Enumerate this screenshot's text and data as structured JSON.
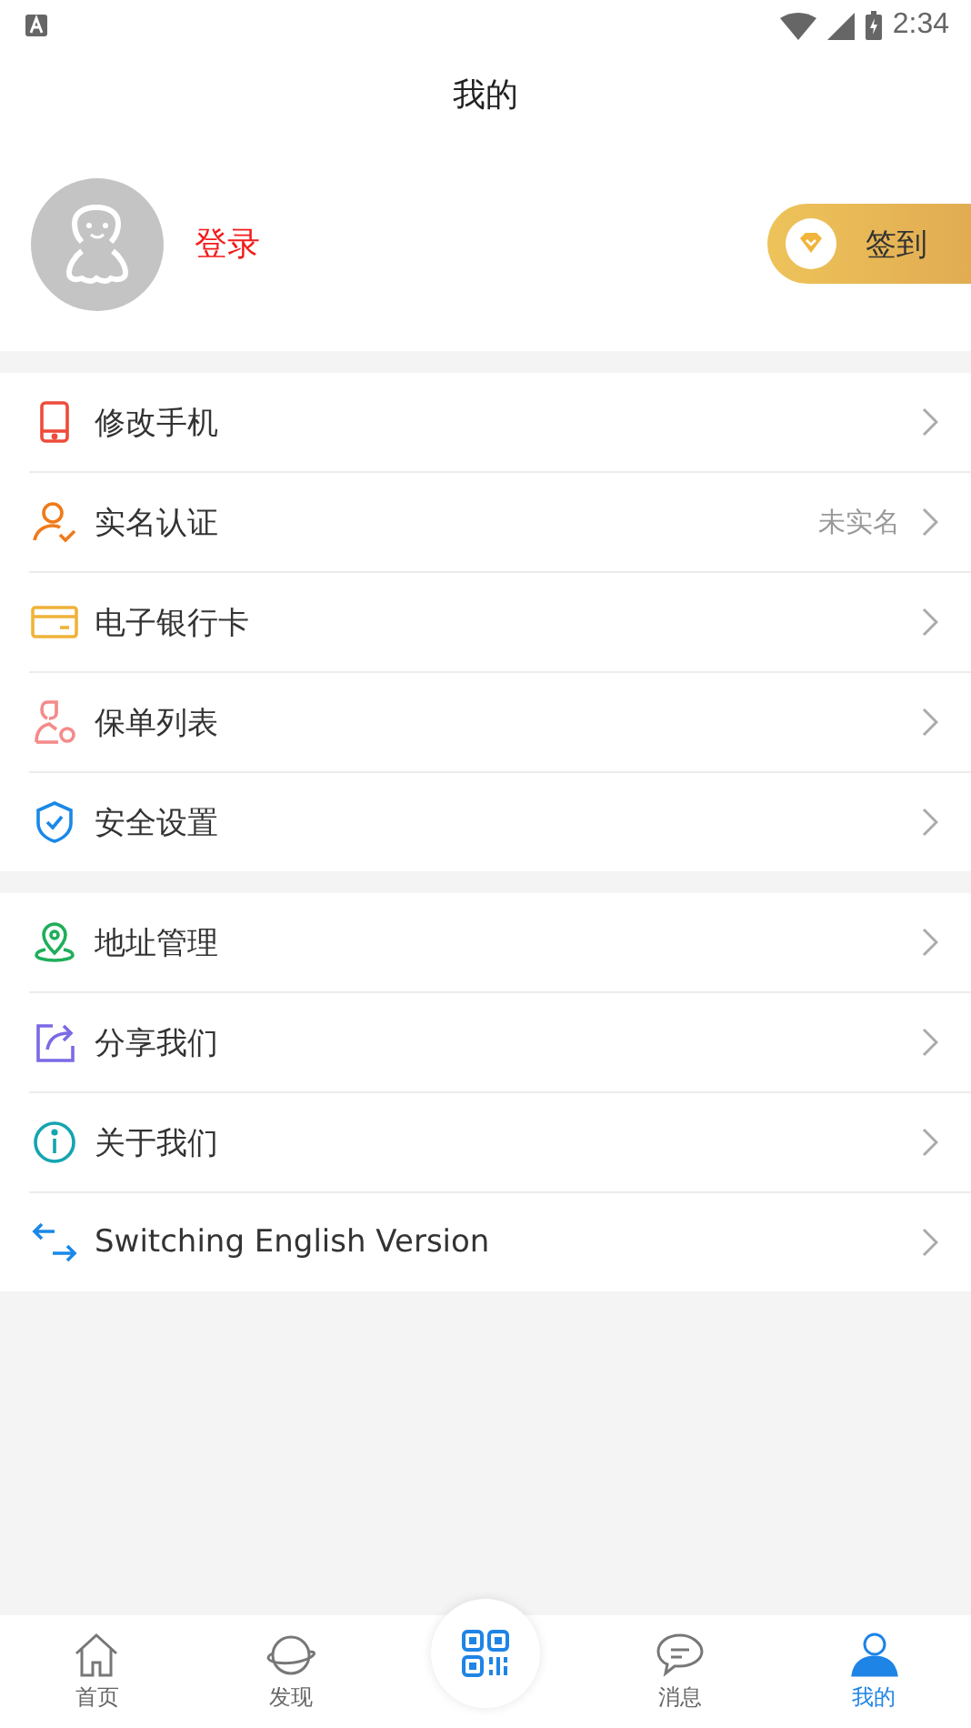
{
  "status_bar": {
    "time": "2:34"
  },
  "header": {
    "title": "我的"
  },
  "profile": {
    "login": "登录",
    "checkin": "签到"
  },
  "menu_groups": [
    [
      {
        "kind": "phone",
        "label": "修改手机"
      },
      {
        "kind": "person-check",
        "label": "实名认证",
        "value": "未实名"
      },
      {
        "kind": "card",
        "label": "电子银行卡"
      },
      {
        "kind": "policy",
        "label": "保单列表"
      },
      {
        "kind": "shield",
        "label": "安全设置"
      }
    ],
    [
      {
        "kind": "location",
        "label": "地址管理"
      },
      {
        "kind": "share",
        "label": "分享我们"
      },
      {
        "kind": "info",
        "label": "关于我们"
      },
      {
        "kind": "swap",
        "label": "Switching English Version"
      }
    ]
  ],
  "tab_bar": [
    {
      "kind": "home",
      "label": "首页",
      "selected": false
    },
    {
      "kind": "planet",
      "label": "发现",
      "selected": false
    },
    {
      "kind": "scan",
      "selected": false
    },
    {
      "kind": "chat",
      "label": "消息",
      "selected": false
    },
    {
      "kind": "user",
      "label": "我的",
      "selected": true
    }
  ]
}
